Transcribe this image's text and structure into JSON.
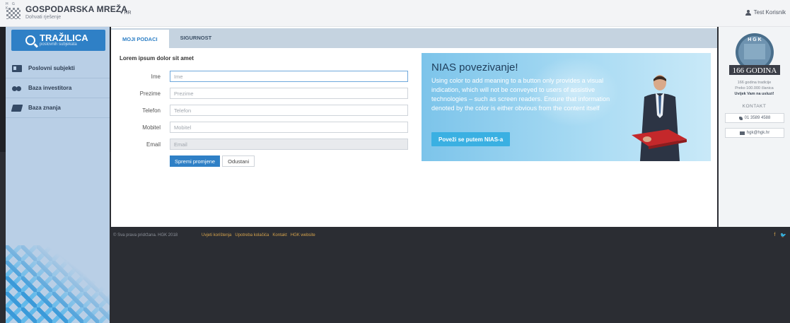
{
  "header": {
    "brand": "GOSPODARSKA MREŽA",
    "tagline": "Dohvati rješenje",
    "logo_letters": "H G K",
    "language": "▾ HR",
    "user": "Test Korisnik"
  },
  "sidebar": {
    "search_title": "TRAŽILICA",
    "search_subtitle": "poslovnih subjekata",
    "items": [
      {
        "label": "Poslovni subjekti",
        "icon": "id-card-icon"
      },
      {
        "label": "Baza investitora",
        "icon": "people-icon"
      },
      {
        "label": "Baza znanja",
        "icon": "book-icon"
      }
    ]
  },
  "tabs": [
    {
      "label": "MOJI PODACI",
      "active": true
    },
    {
      "label": "SIGURNOST",
      "active": false
    }
  ],
  "form": {
    "title": "Lorem ipsum dolor sit amet",
    "fields": [
      {
        "label": "Ime",
        "placeholder": "Ime",
        "value": ""
      },
      {
        "label": "Prezime",
        "placeholder": "Prezime",
        "value": ""
      },
      {
        "label": "Telefon",
        "placeholder": "Telefon",
        "value": ""
      },
      {
        "label": "Mobitel",
        "placeholder": "Mobitel",
        "value": ""
      },
      {
        "label": "Email",
        "placeholder": "Email",
        "value": ""
      }
    ],
    "save_label": "Spremi promjene",
    "cancel_label": "Odustani"
  },
  "nias": {
    "title": "NIAS povezivanje!",
    "text": "Using color to add meaning to a button only provides a visual indication, which will not be conveyed to users of assistive technologies – such as screen readers. Ensure that information denoted by the color is either obvious from the content itself",
    "button": "Poveži se putem NIAS-a"
  },
  "right_panel": {
    "badge_top": "H G K",
    "badge_years": "166 GODINA",
    "info_line1": "166 godina tradicije",
    "info_line2": "Preko 100.000 članica",
    "info_line3": "Uvijek Vam na usluzi!",
    "kontakt": "KONTAKT",
    "phone": "01 3589 4588",
    "email": "hgk@hgk.hr"
  },
  "footer": {
    "copyright": "© Sva prava pridržana. HGK 2018",
    "links": [
      "Uvjeti korištenja",
      "Upotreba kolačića",
      "Kontakt",
      "HGK website"
    ],
    "social": [
      "f",
      "🐦"
    ]
  },
  "colors": {
    "primary": "#2f80c6",
    "sidebar": "#b9cfe6",
    "footer": "#2b2d33",
    "footer_link": "#d4a24c"
  }
}
